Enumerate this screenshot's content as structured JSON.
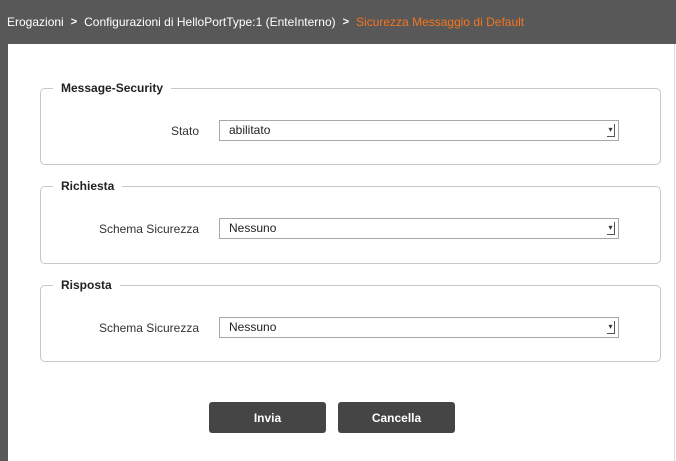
{
  "breadcrumb": {
    "items": [
      "Erogazioni",
      "Configurazioni di HelloPortType:1 (EnteInterno)"
    ],
    "separator": ">",
    "current": "Sicurezza Messaggio di Default"
  },
  "sections": {
    "message_security": {
      "legend": "Message-Security",
      "label": "Stato",
      "value": "abilitato"
    },
    "richiesta": {
      "legend": "Richiesta",
      "label": "Schema Sicurezza",
      "value": "Nessuno"
    },
    "risposta": {
      "legend": "Risposta",
      "label": "Schema Sicurezza",
      "value": "Nessuno"
    }
  },
  "buttons": {
    "invia": "Invia",
    "cancella": "Cancella"
  },
  "colors": {
    "header_bg": "#585858",
    "current_crumb": "#f5751f",
    "button_bg": "#454545"
  }
}
